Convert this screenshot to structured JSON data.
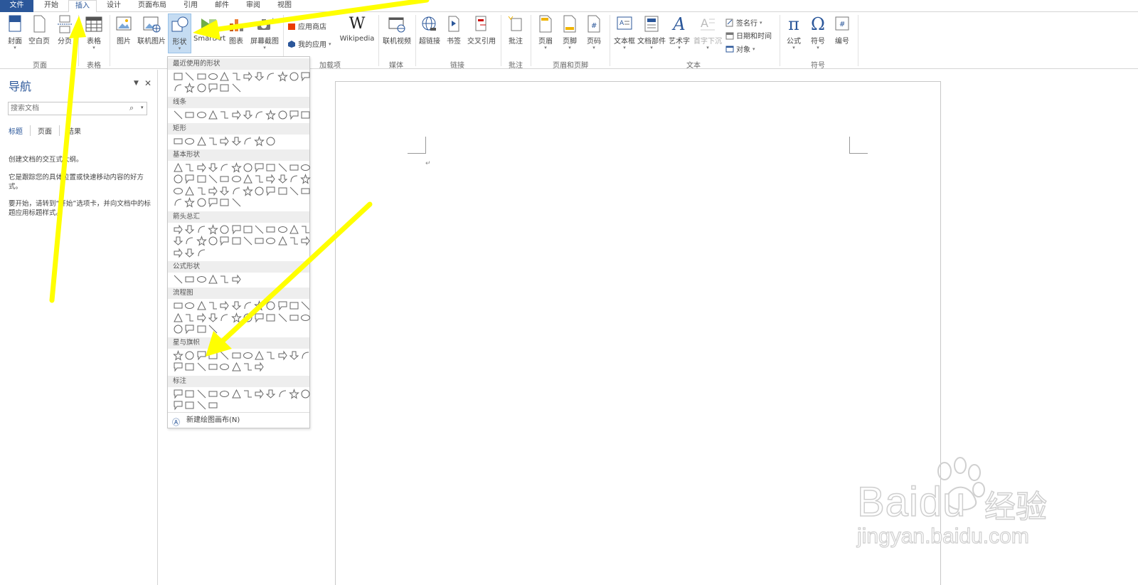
{
  "tabs": {
    "file": "文件",
    "home": "开始",
    "insert": "插入",
    "design": "设计",
    "layout": "页面布局",
    "references": "引用",
    "mailings": "邮件",
    "review": "审阅",
    "view": "视图"
  },
  "ribbon": {
    "pages": {
      "cover": "封面",
      "blank": "空白页",
      "break": "分页",
      "label": "页面"
    },
    "tables": {
      "table": "表格",
      "label": "表格"
    },
    "illustrations": {
      "pictures": "图片",
      "online_pictures": "联机图片",
      "shapes": "形状",
      "smartart": "SmartArt",
      "chart": "图表",
      "screenshot": "屏幕截图"
    },
    "addins": {
      "store": "应用商店",
      "my_apps": "我的应用",
      "wikipedia": "Wikipedia",
      "label": "加载项"
    },
    "media": {
      "online_video": "联机视频",
      "label": "媒体"
    },
    "links": {
      "hyperlink": "超链接",
      "bookmark": "书签",
      "cross_ref": "交叉引用",
      "label": "链接"
    },
    "comments": {
      "comment": "批注",
      "label": "批注"
    },
    "header_footer": {
      "header": "页眉",
      "footer": "页脚",
      "page_number": "页码",
      "label": "页眉和页脚"
    },
    "text": {
      "textbox": "文本框",
      "quick_parts": "文档部件",
      "wordart": "艺术字",
      "dropcap": "首字下沉",
      "signature": "签名行",
      "datetime": "日期和时间",
      "object": "对象",
      "label": "文本"
    },
    "symbols": {
      "equation": "公式",
      "symbol": "符号",
      "number": "编号",
      "label": "符号"
    }
  },
  "nav": {
    "title": "导航",
    "search_placeholder": "搜索文档",
    "tabs": [
      "标题",
      "页面",
      "结果"
    ],
    "paragraphs": [
      "创建文档的交互式大纲。",
      "它是跟踪您的具体位置或快速移动内容的好方式。",
      "要开始，请转到“开始”选项卡，并向文档中的标题应用标题样式。"
    ]
  },
  "gallery": {
    "categories": [
      "最近使用的形状",
      "线条",
      "矩形",
      "基本形状",
      "箭头总汇",
      "公式形状",
      "流程图",
      "星与旗帜",
      "标注"
    ],
    "new_canvas": "新建绘图画布(N)"
  },
  "watermark": {
    "brand": "Baidu",
    "brand_cn": "经验",
    "url": "jingyan.baidu.com"
  },
  "colors": {
    "accent": "#2b579a",
    "arrow": "#ffff00",
    "selected": "#c5dcf2"
  }
}
